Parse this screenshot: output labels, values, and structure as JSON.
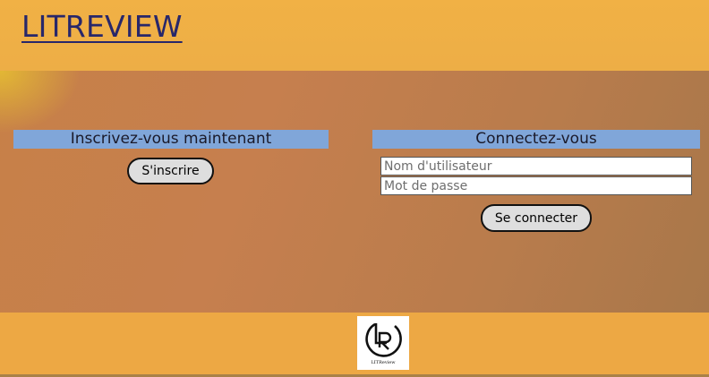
{
  "header": {
    "site_title": "LITREVIEW"
  },
  "signup": {
    "heading": "Inscrivez-vous maintenant",
    "button_label": "S'inscrire"
  },
  "login": {
    "heading": "Connectez-vous",
    "username_placeholder": "Nom d'utilisateur",
    "password_placeholder": "Mot de passe",
    "button_label": "Se connecter"
  },
  "footer": {
    "logo_caption": "LITReview",
    "logo_icon": "litreview-logo-icon"
  },
  "colors": {
    "heading_bar": "#80a6d9",
    "title_text": "#28276a",
    "header_bg": "#f1b145"
  }
}
